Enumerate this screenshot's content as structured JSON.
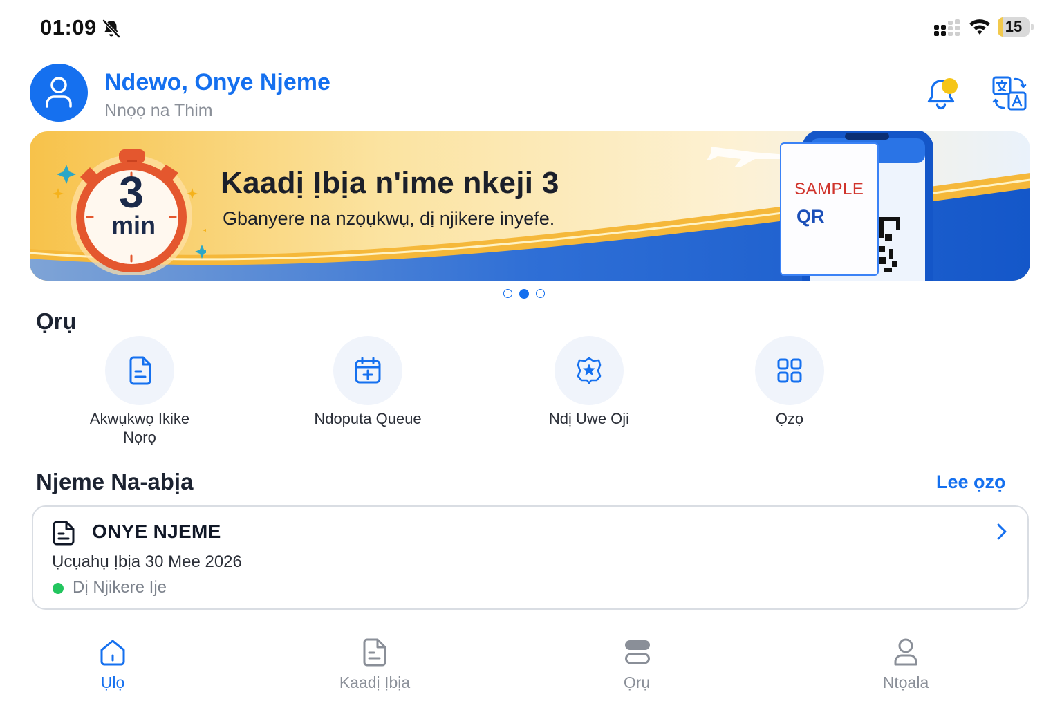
{
  "status_bar": {
    "time": "01:09",
    "battery_level": "15",
    "battery_fraction": 0.15,
    "icons": [
      "bell-off-icon",
      "signal-icon",
      "wifi-icon",
      "battery-icon"
    ]
  },
  "header": {
    "greeting": "Ndewo, Onye Njeme",
    "subtitle": "Nnọọ na Thim",
    "icons": [
      "avatar-icon",
      "notification-bell-icon",
      "translate-icon"
    ],
    "notification_dot_color": "#f5c518"
  },
  "banner": {
    "title": "Kaadị Ịbịa n'ime nkeji 3",
    "subtitle": "Gbanyere na nzọụkwụ, dị njikere inyefe.",
    "timer_number": "3",
    "timer_unit": "min",
    "qr_sample": "SAMPLE",
    "qr_label": "QR",
    "slide_count": 3,
    "active_slide": 2
  },
  "services": {
    "title": "Ọrụ",
    "items": [
      {
        "label": "Akwụkwọ Ikike Nọrọ",
        "icon": "document-icon"
      },
      {
        "label": "Ndoputa Queue",
        "icon": "calendar-add-icon"
      },
      {
        "label": "Ndị Uwe Oji",
        "icon": "police-badge-icon"
      },
      {
        "label": "Ọzọ",
        "icon": "grid-icon"
      }
    ]
  },
  "recent": {
    "title": "Njeme Na-abịa",
    "see_more": "Lee ọzọ",
    "card": {
      "title": "ONYE NJEME",
      "date": "Ụcụahụ Ịbịa 30 Mee 2026",
      "status": "Dị Njikere Ije",
      "status_color": "#22c55e"
    }
  },
  "bottom_nav": {
    "items": [
      {
        "label": "Ụlọ",
        "icon": "home-icon",
        "active": true
      },
      {
        "label": "Kaadị Ịbịa",
        "icon": "card-document-icon",
        "active": false
      },
      {
        "label": "Ọrụ",
        "icon": "services-stack-icon",
        "active": false
      },
      {
        "label": "Ntọala",
        "icon": "profile-icon",
        "active": false
      }
    ]
  },
  "colors": {
    "accent": "#1570ef",
    "text_primary": "#1c2331",
    "text_muted": "#8a8f98"
  }
}
